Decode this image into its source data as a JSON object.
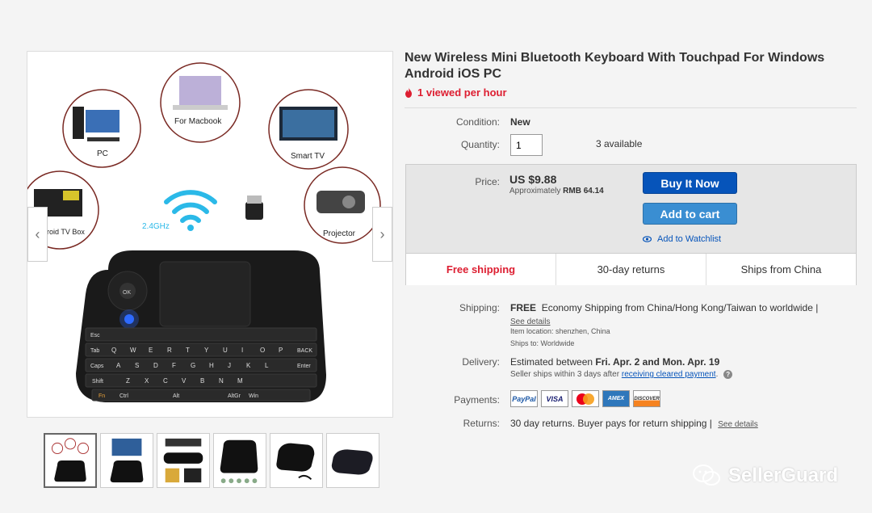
{
  "gallery": {
    "labels": {
      "pc": "PC",
      "macbook": "For Macbook",
      "smart_tv": "Smart TV",
      "tv_box": "Android TV Box",
      "projector": "Projector",
      "ghz": "2.4GHz"
    },
    "keys": {
      "esc": "Esc",
      "tab": "Tab",
      "caps": "Caps",
      "shift": "Shift",
      "fn": "Fn",
      "ctrl": "Ctrl",
      "alt": "Alt",
      "altgr": "AltGr",
      "win": "Win",
      "ok": "OK",
      "row1": [
        "Q",
        "W",
        "E",
        "R",
        "T",
        "Y",
        "U",
        "I",
        "O",
        "P"
      ],
      "row2": [
        "A",
        "S",
        "D",
        "F",
        "G",
        "H",
        "J",
        "K",
        "L"
      ],
      "row3": [
        "Z",
        "X",
        "C",
        "V",
        "B",
        "N",
        "M"
      ],
      "back": "BACK",
      "enter": "Enter"
    }
  },
  "product": {
    "title": "New Wireless Mini Bluetooth Keyboard With Touchpad For Windows Android iOS PC",
    "viewed": "1 viewed per hour",
    "condition_label": "Condition:",
    "condition_value": "New",
    "quantity_label": "Quantity:",
    "quantity_value": "1",
    "available": "3 available"
  },
  "buybox": {
    "price_label": "Price:",
    "price_value": "US $9.88",
    "approx_prefix": "Approximately",
    "approx_value": "RMB 64.14",
    "buy_now": "Buy It Now",
    "add_to_cart": "Add to cart",
    "add_to_watchlist": "Add to Watchlist",
    "features": [
      "Free shipping",
      "30-day returns",
      "Ships from China"
    ]
  },
  "shipping": {
    "label": "Shipping:",
    "free": "FREE",
    "text": "Economy Shipping from China/Hong Kong/Taiwan to worldwide |",
    "see_details": "See details",
    "item_location": "Item location:  shenzhen, China",
    "ships_to": "Ships to:  Worldwide"
  },
  "delivery": {
    "label": "Delivery:",
    "estimated_prefix": "Estimated between",
    "date1": "Fri. Apr. 2",
    "and": "and",
    "date2": "Mon. Apr. 19",
    "seller_ships": "Seller ships within 3 days after",
    "receiving_link": "receiving cleared payment",
    "period": "."
  },
  "payments": {
    "label": "Payments:",
    "methods": [
      "PayPal",
      "VISA",
      "MasterCard",
      "AMEX",
      "DISCOVER"
    ]
  },
  "returns": {
    "label": "Returns:",
    "text": "30 day returns. Buyer pays for return shipping |",
    "see_details": "See details"
  },
  "watermark": {
    "text": "SellerGuard"
  },
  "colors": {
    "accent_red": "#dd1e31",
    "buy_blue": "#0654ba",
    "cart_blue": "#3a8ed2"
  }
}
